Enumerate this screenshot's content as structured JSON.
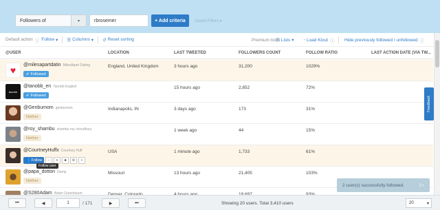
{
  "search": {
    "criteria_type": "Followers of",
    "criteria_value": "rbrosemer",
    "add_button": "+ Add criteria",
    "saved_filters": "Saved Filters ▾"
  },
  "toolbar": {
    "default_action_label": "Default action",
    "default_action_value": "Follow",
    "columns": "Columns",
    "reset_sorting": "Reset sorting",
    "premium_tools": "Premium tools",
    "lists": "Lists",
    "load_klout": "Load Klout",
    "hide_previously": "Hide previously followed / unfollowed"
  },
  "columns": [
    "@USER",
    "LOCATION",
    "LAST TWEETED",
    "FOLLOWERS COUNT",
    "FOLLOW RATIO",
    "LAST ACTION DATE (VIA TW..."
  ],
  "rows": [
    {
      "handle": "@milesapartdatin",
      "fullname": "MilesApart Dating",
      "status": "Followed",
      "location": "England, United Kingdom",
      "last_tweeted": "3 hours ago",
      "followers": "31,200",
      "ratio": "1029%",
      "avatar_color": "#e8243a"
    },
    {
      "handle": "@tanobb_en",
      "fullname": "Tanobb English",
      "status": "Followed",
      "location": "",
      "last_tweeted": "15 hours ago",
      "followers": "2,852",
      "ratio": "72%",
      "avatar_color": "#111111"
    },
    {
      "handle": "@Genbumom",
      "fullname": "genbumom",
      "status": "Neither",
      "location": "Indianapolis, IN",
      "last_tweeted": "3 days ago",
      "followers": "173",
      "ratio": "31%",
      "avatar_color": "#b07a58"
    },
    {
      "handle": "@roy_shambu",
      "fullname": "shambu roy choudhury",
      "status": "Neither",
      "location": "",
      "last_tweeted": "1 week ago",
      "followers": "44",
      "ratio": "15%",
      "avatar_color": "#8a8f96"
    },
    {
      "handle": "@CourtneyHuffx",
      "fullname": "Courtney Huff",
      "status": "",
      "location": "USA",
      "last_tweeted": "1 minute ago",
      "followers": "1,733",
      "ratio": "61%",
      "avatar_color": "#5a4a42"
    },
    {
      "handle": "@papa_dotton",
      "fullname": "Damp",
      "status": "Neither",
      "location": "Missouri",
      "last_tweeted": "13 hours ago",
      "followers": "21,405",
      "ratio": "103%",
      "avatar_color": "#d9a033"
    },
    {
      "handle": "@S280Adam",
      "fullname": "Adam Greenbaum",
      "status": "",
      "location": "Denver, Colorado",
      "last_tweeted": "4 hours ago",
      "followers": "18,697",
      "ratio": "93%",
      "avatar_color": "#a08060"
    }
  ],
  "row_actions": {
    "follow_label": "Follow",
    "tooltip": "Follow user"
  },
  "feedback": "Feedback",
  "toast": {
    "message": "2 user(s) successfully followed.",
    "close": "5×"
  },
  "pager": {
    "first": "⏮",
    "prev": "◀",
    "page": "1",
    "total": "/ 171",
    "next": "▶",
    "last": "⏭",
    "info": "Showing 20 users. Total 3,410 users",
    "page_size": "20"
  },
  "colors": {
    "accent": "#2e7bc7",
    "topbar": "#bfe0f2",
    "row_highlight": "#fdf6e8"
  }
}
